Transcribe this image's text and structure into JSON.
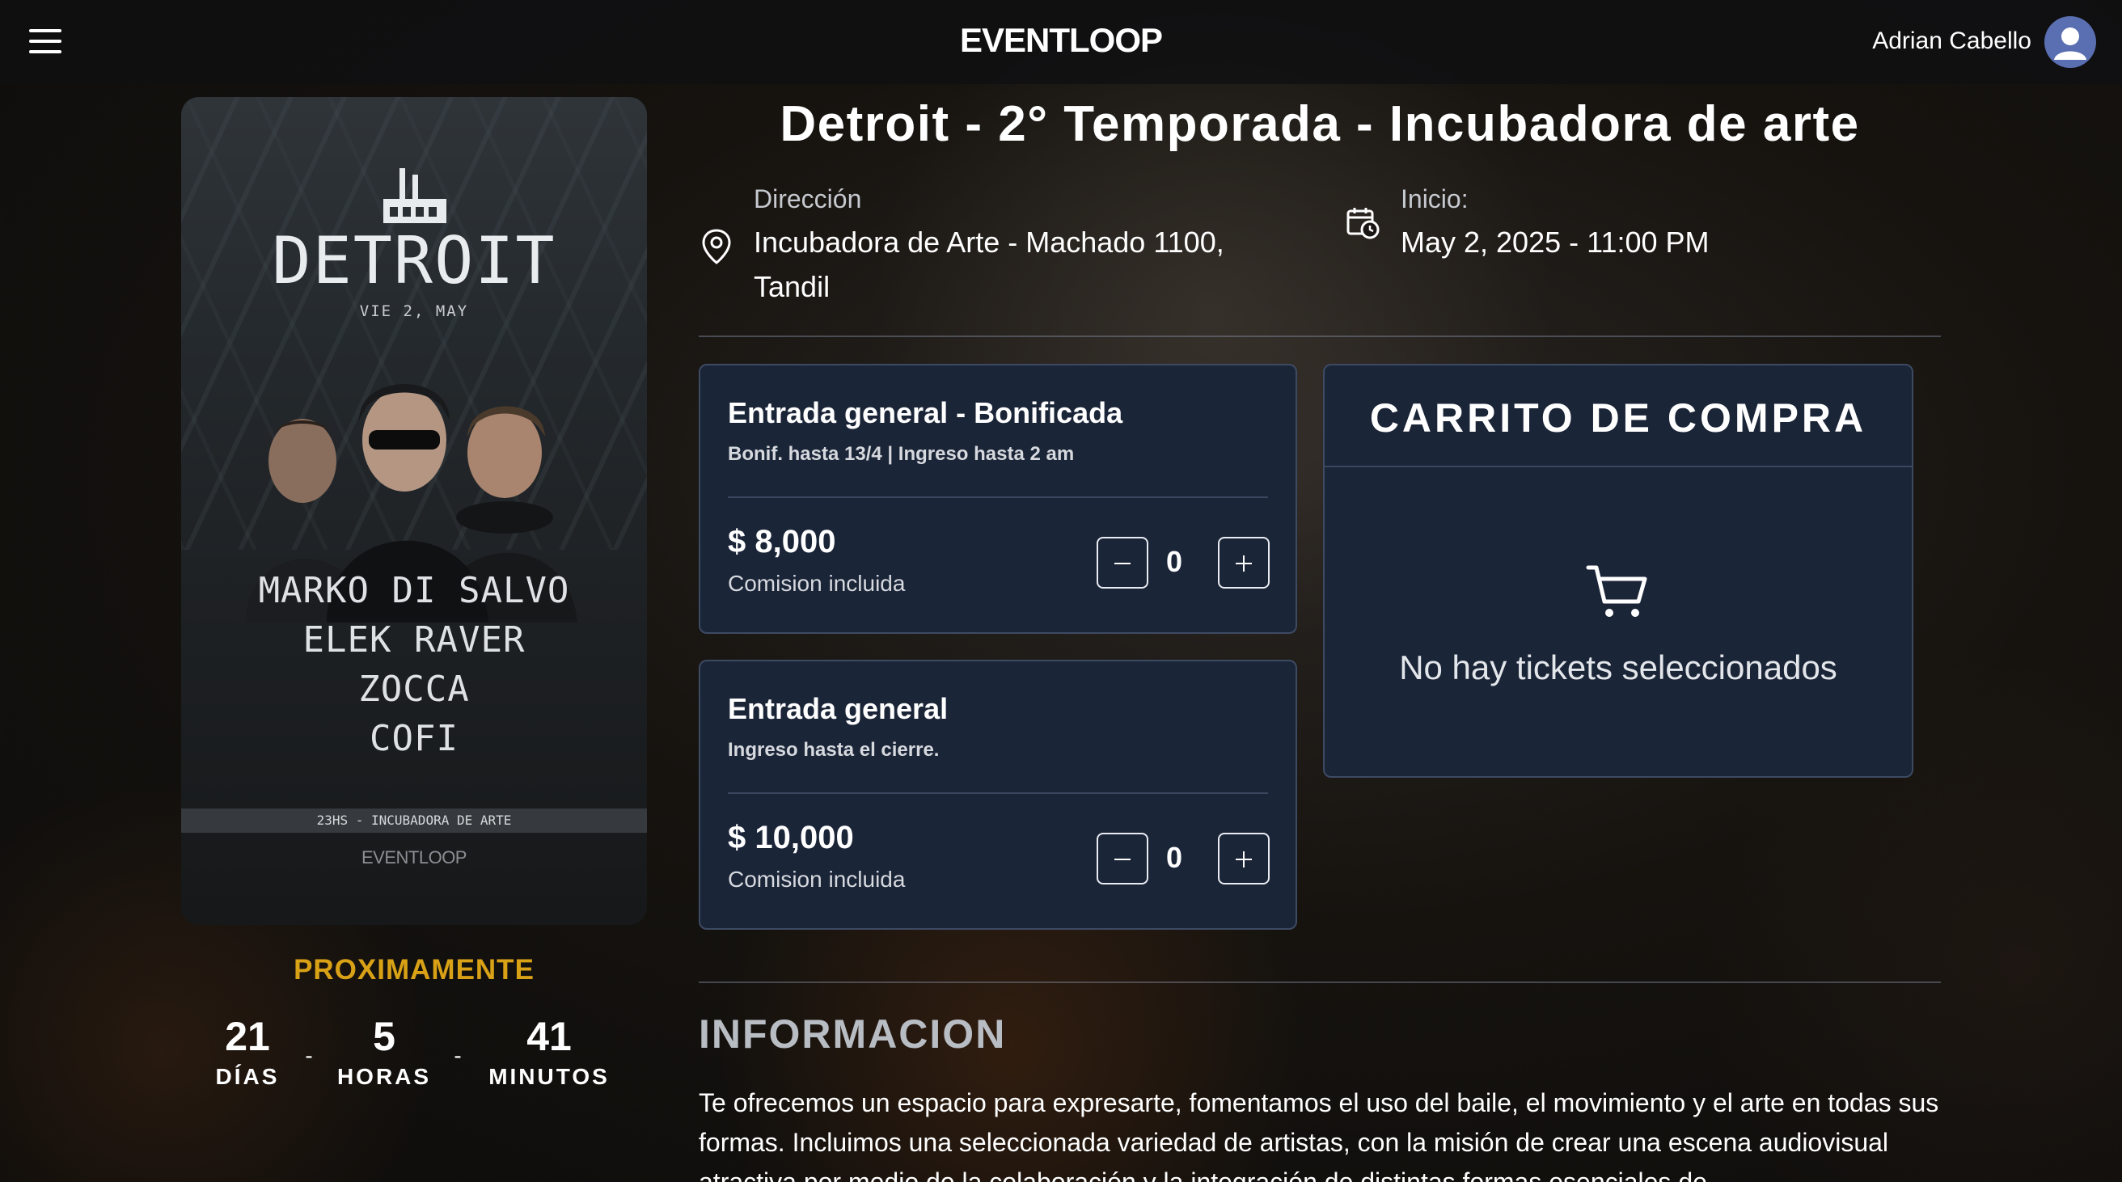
{
  "header": {
    "brand": "EVENTLOOP",
    "user_name": "Adrian Cabello"
  },
  "poster": {
    "title": "DETROIT",
    "date": "VIE 2, MAY",
    "artists": [
      "MARKO DI SALVO",
      "ELEK RAVER",
      "ZOCCA",
      "COFI"
    ],
    "strip": "23HS - INCUBADORA DE ARTE",
    "brand": "EVENTLOOP"
  },
  "countdown": {
    "status": "PROXIMAMENTE",
    "units": [
      {
        "value": "21",
        "label": "DÍAS"
      },
      {
        "value": "5",
        "label": "HORAS"
      },
      {
        "value": "41",
        "label": "MINUTOS"
      }
    ],
    "separator": "-"
  },
  "event": {
    "title": "Detroit - 2° Temporada - Incubadora de arte",
    "address_label": "Dirección",
    "address_line1": "Incubadora de Arte - Machado 1100,",
    "address_line2": "Tandil",
    "start_label": "Inicio:",
    "start_value": "May 2, 2025 - 11:00 PM"
  },
  "tickets": [
    {
      "name": "Entrada general - Bonificada",
      "description": "Bonif. hasta 13/4 | Ingreso hasta 2 am",
      "price": "$ 8,000",
      "fee_note": "Comision incluida",
      "quantity": "0"
    },
    {
      "name": "Entrada general",
      "description": "Ingreso hasta el cierre.",
      "price": "$ 10,000",
      "fee_note": "Comision incluida",
      "quantity": "0"
    }
  ],
  "cart": {
    "title": "CARRITO DE COMPRA",
    "empty_message": "No hay tickets seleccionados"
  },
  "info": {
    "title": "INFORMACION",
    "text": "Te ofrecemos un espacio para expresarte, fomentamos el uso del baile, el movimiento y el arte en todas sus formas. Incluimos una seleccionada variedad de artistas, con la misión de crear una escena audiovisual atractiva por medio de la colaboración y la integración de distintas formas esenciales de"
  },
  "colors": {
    "accent": "#d9a116",
    "card_bg": "#1b2538",
    "card_border": "#3d4a63",
    "avatar_bg": "#5a6fb2"
  }
}
